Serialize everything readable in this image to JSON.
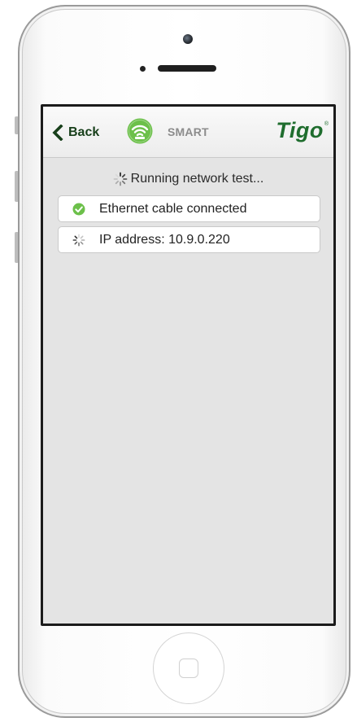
{
  "navbar": {
    "back_label": "Back",
    "mode_label": "SMART",
    "brand": "Tigo",
    "brand_mark": "®"
  },
  "status": {
    "text": "Running network test..."
  },
  "checks": [
    {
      "label": "Ethernet cable connected",
      "state": "success",
      "icon": "check-circle-icon"
    },
    {
      "label": "IP address: 10.9.0.220",
      "state": "in-progress",
      "icon": "spinner-icon"
    }
  ],
  "colors": {
    "brand": "#1f6d2e",
    "back": "#173f1a",
    "success": "#6cc04a",
    "wifi": "#6cc04a",
    "background": "#e4e4e4"
  }
}
